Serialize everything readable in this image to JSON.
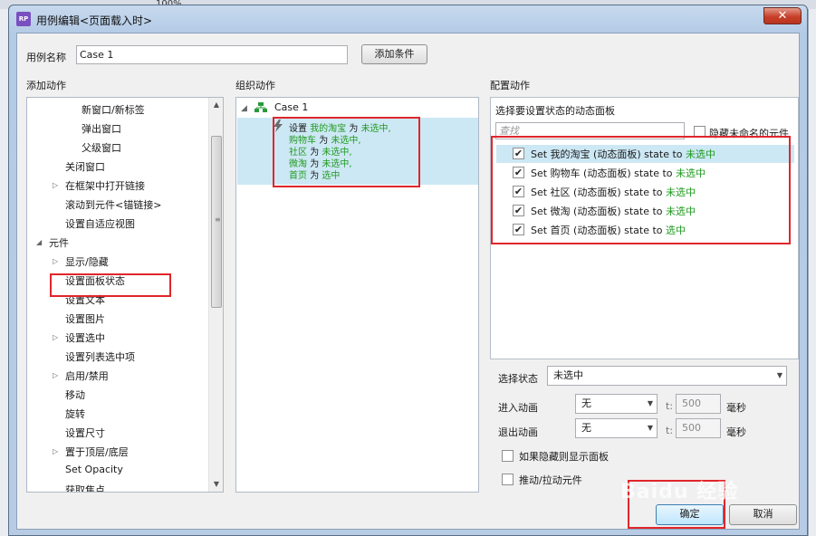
{
  "background": {
    "zoom_readout": "100%"
  },
  "dialog": {
    "title": "用例编辑<页面载入时>",
    "close_symbol": "✕",
    "app_icon_text": "RP",
    "case_name_label": "用例名称",
    "case_name_value": "Case 1",
    "add_condition_button": "添加条件",
    "confirm_button": "确定",
    "cancel_button": "取消"
  },
  "left_panel": {
    "heading": "添加动作",
    "items": [
      {
        "label": "新窗口/新标签",
        "indent": 3,
        "expander": ""
      },
      {
        "label": "弹出窗口",
        "indent": 3,
        "expander": ""
      },
      {
        "label": "父级窗口",
        "indent": 3,
        "expander": ""
      },
      {
        "label": "关闭窗口",
        "indent": 2,
        "expander": ""
      },
      {
        "label": "在框架中打开链接",
        "indent": 2,
        "expander": "▷"
      },
      {
        "label": "滚动到元件<锚链接>",
        "indent": 2,
        "expander": ""
      },
      {
        "label": "设置自适应视图",
        "indent": 2,
        "expander": ""
      },
      {
        "label": "元件",
        "indent": 1,
        "expander": "◢"
      },
      {
        "label": "显示/隐藏",
        "indent": 2,
        "expander": "▷"
      },
      {
        "label": "设置面板状态",
        "indent": 2,
        "expander": ""
      },
      {
        "label": "设置文本",
        "indent": 2,
        "expander": ""
      },
      {
        "label": "设置图片",
        "indent": 2,
        "expander": ""
      },
      {
        "label": "设置选中",
        "indent": 2,
        "expander": "▷"
      },
      {
        "label": "设置列表选中项",
        "indent": 2,
        "expander": ""
      },
      {
        "label": "启用/禁用",
        "indent": 2,
        "expander": "▷"
      },
      {
        "label": "移动",
        "indent": 2,
        "expander": ""
      },
      {
        "label": "旋转",
        "indent": 2,
        "expander": ""
      },
      {
        "label": "设置尺寸",
        "indent": 2,
        "expander": ""
      },
      {
        "label": "置于顶层/底层",
        "indent": 2,
        "expander": "▷"
      },
      {
        "label": "Set Opacity",
        "indent": 2,
        "expander": ""
      },
      {
        "label": "获取焦点",
        "indent": 2,
        "expander": ""
      }
    ]
  },
  "middle_panel": {
    "heading": "组织动作",
    "case_label": "Case 1",
    "action_prefix": "设置",
    "action_lines": [
      {
        "name": "我的淘宝",
        "mid": "为",
        "state": "未选中,"
      },
      {
        "name": "购物车",
        "mid": "为",
        "state": "未选中,"
      },
      {
        "name": "社区",
        "mid": "为",
        "state": "未选中,"
      },
      {
        "name": "微淘",
        "mid": "为",
        "state": "未选中,"
      },
      {
        "name": "首页",
        "mid": "为",
        "state": "选中"
      }
    ]
  },
  "right_panel": {
    "heading": "配置动作",
    "subheading": "选择要设置状态的动态面板",
    "search_placeholder": "查找",
    "hide_unnamed_label": "隐藏未命名的元件",
    "rows": [
      {
        "prefix": "Set 我的淘宝 (动态面板) state to",
        "state": "未选中",
        "checked": true
      },
      {
        "prefix": "Set 购物车 (动态面板) state to",
        "state": "未选中",
        "checked": true
      },
      {
        "prefix": "Set 社区 (动态面板) state to",
        "state": "未选中",
        "checked": true
      },
      {
        "prefix": "Set 微淘 (动态面板) state to",
        "state": "未选中",
        "checked": true
      },
      {
        "prefix": "Set 首页 (动态面板) state to",
        "state": "选中",
        "checked": true
      }
    ],
    "select_state_label": "选择状态",
    "select_state_value": "未选中",
    "enter_anim_label": "进入动画",
    "enter_anim_value": "无",
    "exit_anim_label": "退出动画",
    "exit_anim_value": "无",
    "t_label": "t:",
    "duration_value": "500",
    "ms_label": "毫秒",
    "show_if_hidden_label": "如果隐藏则显示面板",
    "push_pull_label": "推动/拉动元件"
  },
  "watermark_text": "Baidu 经验",
  "colors": {
    "highlight_red": "#e0262b",
    "state_green": "#1f9a1f",
    "row_highlight": "#cde8f5"
  }
}
